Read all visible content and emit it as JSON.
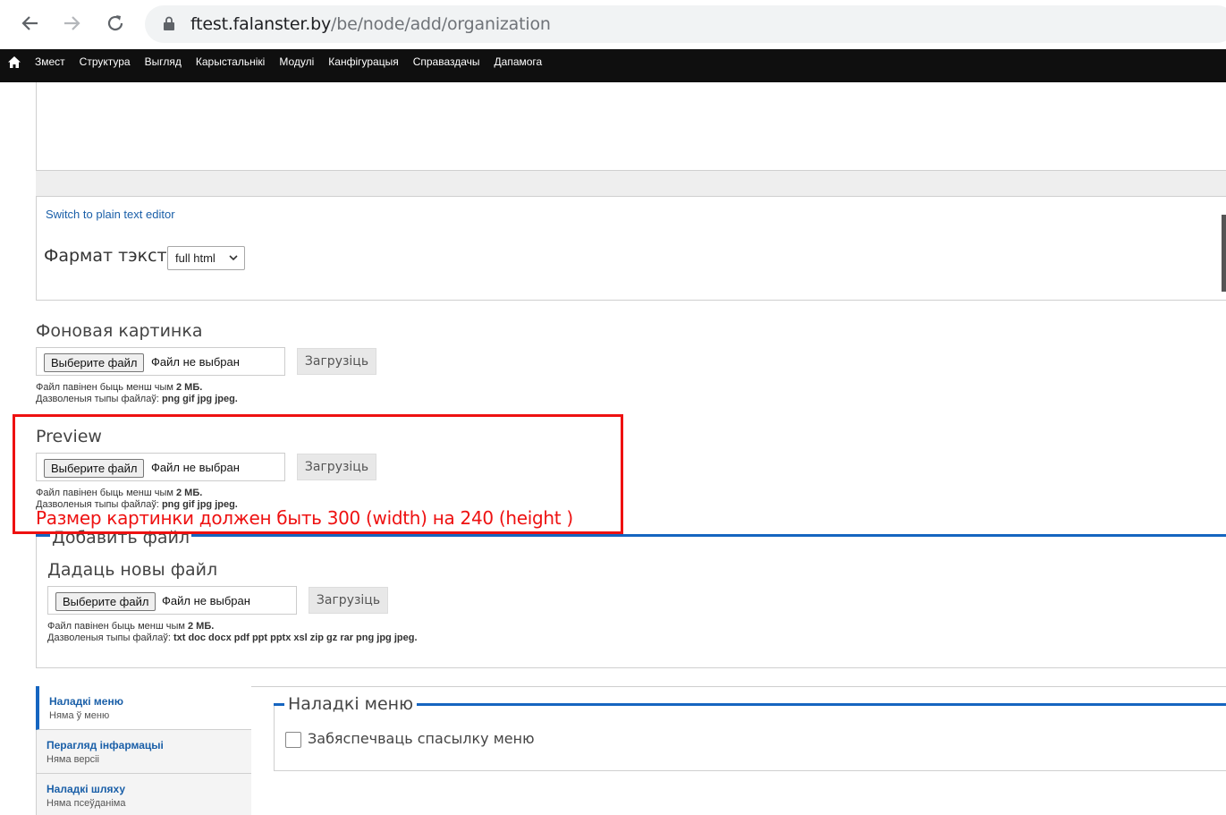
{
  "browser": {
    "url_host": "ftest.falanster.by",
    "url_path": "/be/node/add/organization"
  },
  "toolbar": {
    "items": [
      "Змест",
      "Структура",
      "Выгляд",
      "Карыстальнікі",
      "Модулі",
      "Канфігурацыя",
      "Справаздачы",
      "Дапамога"
    ]
  },
  "editor": {
    "switch_link": "Switch to plain text editor",
    "format_label": "Фармат тэксту",
    "format_value": "full html"
  },
  "background_image": {
    "label": "Фоновая картинка",
    "choose_label": "Выберите файл",
    "no_file": "Файл не выбран",
    "upload_label": "Загрузіць",
    "help_size_prefix": "Файл павінен быць менш чым ",
    "help_size_value": "2 МБ.",
    "help_types_prefix": "Дазволеныя тыпы файлаў: ",
    "help_types_value": "png gif jpg jpeg."
  },
  "preview": {
    "label": "Preview",
    "choose_label": "Выберите файл",
    "no_file": "Файл не выбран",
    "upload_label": "Загрузіць",
    "help_size_prefix": "Файл павінен быць менш чым ",
    "help_size_value": "2 МБ.",
    "help_types_prefix": "Дазволеныя тыпы файлаў: ",
    "help_types_value": "png gif jpg jpeg."
  },
  "annotation": {
    "text": "Размер картинки должен быть 300 (width) на 240 (height )",
    "color": "#ee1111"
  },
  "add_file": {
    "legend": "Добавить файл",
    "label": "Дадаць новы файл",
    "choose_label": "Выберите файл",
    "no_file": "Файл не выбран",
    "upload_label": "Загрузіць",
    "help_size_prefix": "Файл павінен быць менш чым ",
    "help_size_value": "2 МБ.",
    "help_types_prefix": "Дазволеныя тыпы файлаў: ",
    "help_types_value": "txt doc docx pdf ppt pptx xsl zip gz rar png jpg jpeg."
  },
  "vertical_tabs": [
    {
      "title": "Наладкі меню",
      "summary": "Няма ў меню"
    },
    {
      "title": "Перагляд інфармацыі",
      "summary": "Няма версіі"
    },
    {
      "title": "Наладкі шляху",
      "summary": "Няма псеўданіма"
    }
  ],
  "menu_settings": {
    "legend": "Наладкі меню",
    "checkbox_label": "Забяспечваць спасылку меню"
  },
  "colors": {
    "accent": "#1565c0",
    "link": "#1a5fa8",
    "toolbar_bg": "#0f0f0f"
  }
}
